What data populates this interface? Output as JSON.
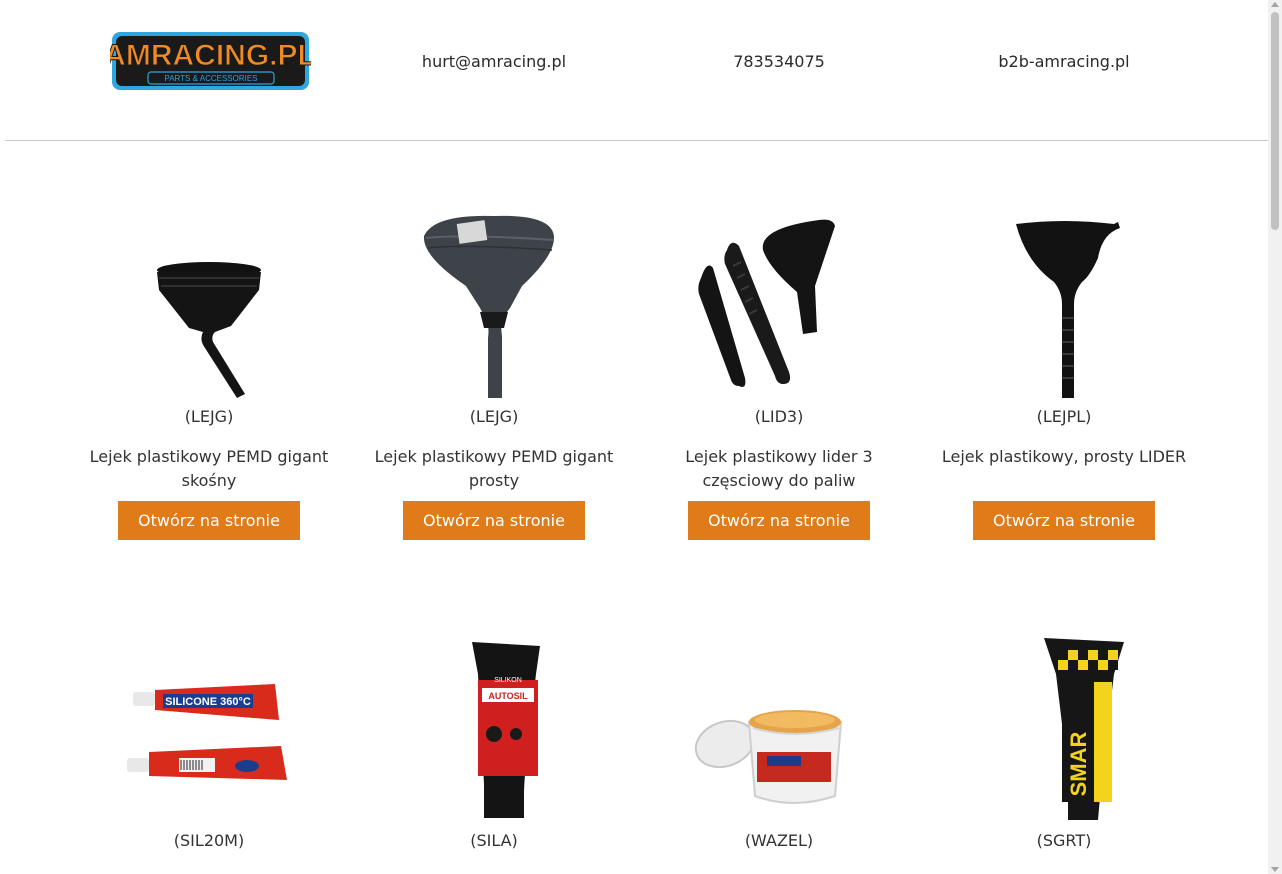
{
  "header": {
    "logo_text": "AMRACING.PL",
    "logo_subtext": "PARTS & ACCESSORIES",
    "email": "hurt@amracing.pl",
    "phone": "783534075",
    "site": "b2b-amracing.pl"
  },
  "products": [
    {
      "code": "(LEJG)",
      "name": "Lejek plastikowy PEMD gigant skośny",
      "button": "Otwórz na stronie",
      "image": "angled-funnel-icon"
    },
    {
      "code": "(LEJG)",
      "name": "Lejek plastikowy PEMD gigant prosty",
      "button": "Otwórz na stronie",
      "image": "large-funnel-icon"
    },
    {
      "code": "(LID3)",
      "name": "Lejek plastikowy lider 3 częsciowy do paliw",
      "button": "Otwórz na stronie",
      "image": "funnel-kit-icon"
    },
    {
      "code": "(LEJPL)",
      "name": "Lejek plastikowy, prosty LIDER",
      "button": "Otwórz na stronie",
      "image": "straight-funnel-icon"
    },
    {
      "code": "(SIL20M)",
      "name": "",
      "button": "",
      "image": "silicone-tubes-icon"
    },
    {
      "code": "(SILA)",
      "name": "",
      "button": "",
      "image": "autosil-tube-icon"
    },
    {
      "code": "(WAZEL)",
      "name": "",
      "button": "",
      "image": "grease-bucket-icon"
    },
    {
      "code": "(SGRT)",
      "name": "",
      "button": "",
      "image": "graphite-grease-tube-icon"
    }
  ],
  "colors": {
    "accent": "#e07b1a",
    "logo_orange": "#f08a24",
    "logo_blue": "#2ea6e0"
  }
}
